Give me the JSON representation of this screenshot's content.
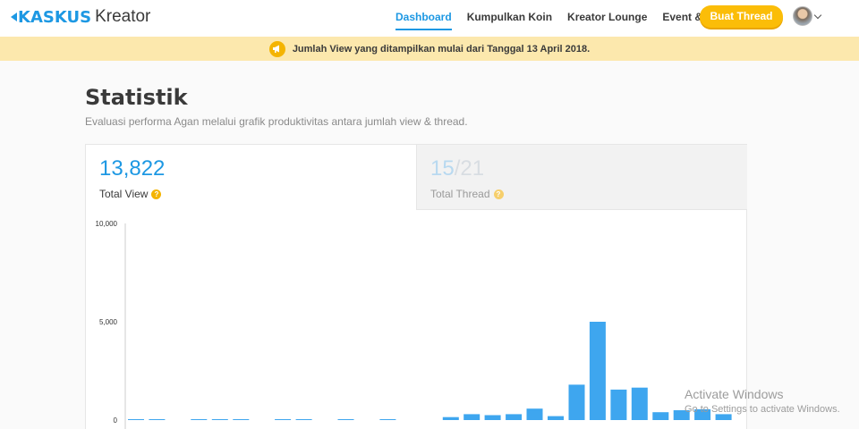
{
  "header": {
    "logo": {
      "brand": "KASKUS",
      "product": "Kreator"
    },
    "nav": [
      {
        "label": "Dashboard",
        "active": true
      },
      {
        "label": "Kumpulkan Koin",
        "active": false
      },
      {
        "label": "Kreator Lounge",
        "active": false
      },
      {
        "label": "Event & Promo",
        "active": false
      }
    ],
    "create_button": "Buat Thread",
    "avatar_icon": "user-avatar",
    "menu_icon": "chevron-down-icon"
  },
  "notice": {
    "icon": "megaphone-icon",
    "text": "Jumlah View yang ditampilkan mulai dari Tanggal 13 April 2018."
  },
  "main": {
    "title": "Statistik",
    "subtitle": "Evaluasi performa Agan melalui grafik produktivitas antara jumlah view & thread.",
    "tabs": {
      "view": {
        "value": "13,822",
        "label": "Total View",
        "help_icon": "question-icon"
      },
      "thread": {
        "current": "15",
        "total": "21",
        "label": "Total Thread",
        "help_icon": "question-icon"
      }
    }
  },
  "chart_data": {
    "type": "bar",
    "ylim": [
      0,
      10000
    ],
    "yticks": [
      {
        "value": 0,
        "label": "0"
      },
      {
        "value": 5000,
        "label": "5,000"
      },
      {
        "value": 10000,
        "label": "10,000"
      }
    ],
    "values": [
      20,
      20,
      0,
      20,
      20,
      20,
      0,
      20,
      20,
      0,
      20,
      0,
      20,
      0,
      0,
      150,
      300,
      250,
      300,
      580,
      200,
      1800,
      5000,
      1550,
      1650,
      400,
      500,
      550,
      300
    ],
    "color": "#3ea6ef",
    "grid": false
  },
  "os_watermark": {
    "line1": "Activate Windows",
    "line2": "Go to Settings to activate Windows."
  },
  "colors": {
    "brand_blue": "#1d98e3",
    "brand_orange": "#f7941d",
    "button_yellow": "#fbbd08",
    "notice_bg": "#fce8ad"
  }
}
